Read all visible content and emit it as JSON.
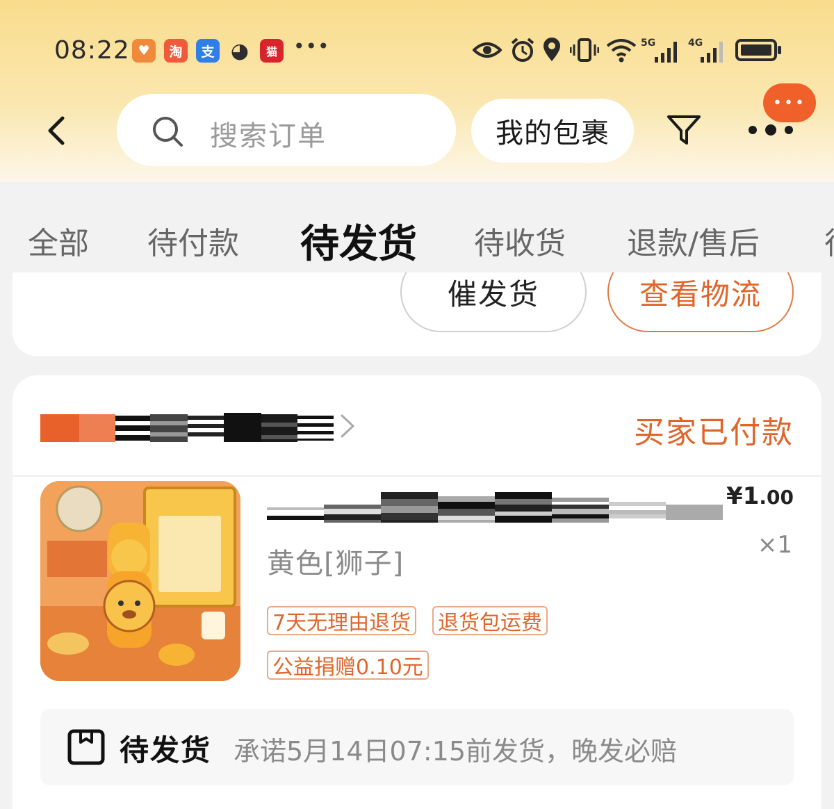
{
  "colors": {
    "accent": "#e0652a",
    "header_top": "#f9dc8c",
    "page_bg": "#f2f2f2",
    "card_bg": "#ffffff"
  },
  "status_bar": {
    "time": "08:22",
    "app_icons": [
      {
        "name": "heart-app-icon",
        "glyph": "♥",
        "color": "#f08a3a"
      },
      {
        "name": "taobao-app-icon",
        "glyph": "淘",
        "color": "#ef5a3a"
      },
      {
        "name": "alipay-app-icon",
        "glyph": "支",
        "color": "#2f7fe6"
      },
      {
        "name": "wechat-app-icon",
        "glyph": "◕",
        "color": "#2e2e2e"
      },
      {
        "name": "tmall-app-icon",
        "glyph": "猫",
        "color": "#d8252c"
      }
    ],
    "overflow": "•••",
    "net_5g": "5G",
    "net_4g": "4G"
  },
  "nav": {
    "search_placeholder": "搜索订单",
    "packages_label": "我的包裹",
    "more_bubble": "•••"
  },
  "tabs": [
    {
      "label": "全部",
      "active": false
    },
    {
      "label": "待付款",
      "active": false
    },
    {
      "label": "待发货",
      "active": true
    },
    {
      "label": "待收货",
      "active": false
    },
    {
      "label": "退款/售后",
      "active": false
    },
    {
      "label": "待",
      "active": false
    }
  ],
  "prev_card": {
    "urge_label": "催发货",
    "track_label": "查看物流"
  },
  "order": {
    "status": "买家已付款",
    "item": {
      "variant": "黄色[狮子]",
      "price_symbol": "¥",
      "price_int": "1",
      "price_dec": ".00",
      "quantity": "×1",
      "tags": [
        "7天无理由退货",
        "退货包运费",
        "公益捐赠0.10元"
      ]
    },
    "shipping": {
      "status": "待发货",
      "note": "承诺5月14日07:15前发货，晚发必赔"
    }
  }
}
